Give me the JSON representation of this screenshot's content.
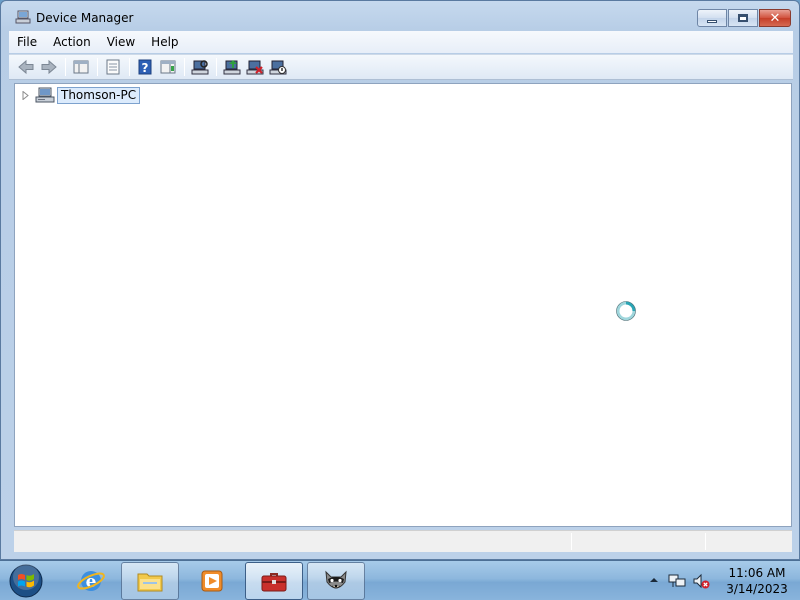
{
  "window": {
    "title": "Device Manager",
    "icon": "device-manager-icon"
  },
  "menu": [
    "File",
    "Action",
    "View",
    "Help"
  ],
  "toolbar": {
    "buttons": [
      "back-icon",
      "forward-icon",
      "show-hide-console-tree-icon",
      "properties-icon",
      "help-icon",
      "show-hide-action-pane-icon",
      "scan-hardware-icon",
      "update-driver-icon",
      "uninstall-device-icon",
      "disable-device-icon"
    ]
  },
  "tree": {
    "root_label": "Thomson-PC",
    "expanded": false
  },
  "taskbar": {
    "apps": [
      "windows-explorer-icon",
      "windows-media-player-icon",
      "toolbox-icon",
      "raccoon-app-icon"
    ],
    "pinned": [
      "internet-explorer-icon"
    ]
  },
  "clock": {
    "time": "11:06 AM",
    "date": "3/14/2023"
  },
  "colors": {
    "selection": "#dcebfc",
    "close_button": "#c53e28",
    "taskbar": "#7aa8d4"
  }
}
